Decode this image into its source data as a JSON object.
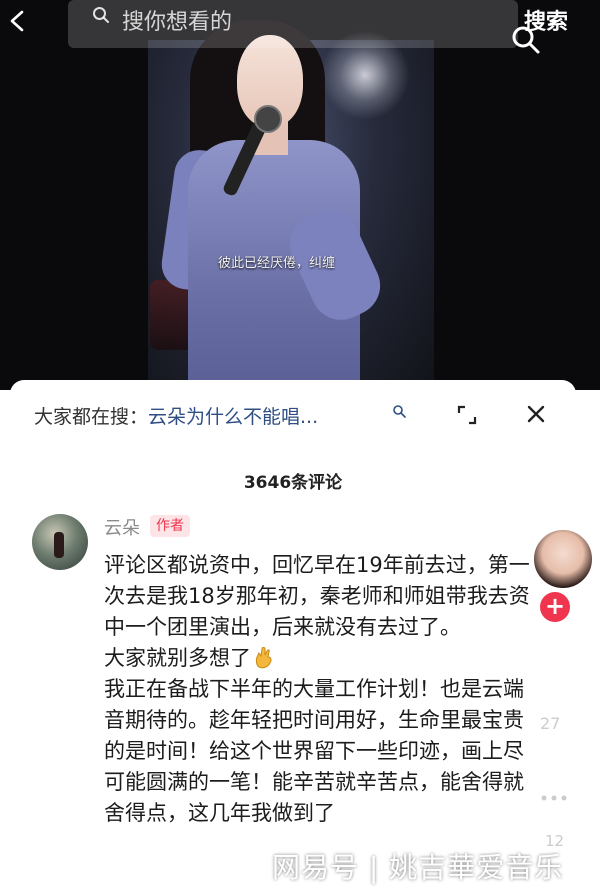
{
  "video": {
    "subtitle": "彼此已经厌倦，纠缠"
  },
  "top_bar": {
    "search_placeholder": "搜你想看的",
    "search_button": "搜索"
  },
  "comments_panel": {
    "hot_search_prefix": "大家都在搜：",
    "hot_search_query": "云朵为什么不能唱...",
    "comment_count": "3646条评论",
    "comment": {
      "author": "云朵",
      "author_badge": "作者",
      "text_part1": "评论区都说资中，回忆早在19年前去过，第一次去是我18岁那年初，秦老师和师姐带我去资中一个团里演出，后来就没有去过了。\n大家就别多想了",
      "text_part2": "\n我正在备战下半年的大量工作计划！也是云端音期待的。趁年轻把时间用好，生命里最宝贵的是时间！给这个世界留下一些印迹，画上尽可能圆满的一笔！能辛苦就辛苦点，能舍得就舍得点，这几年我做到了"
    }
  },
  "right_rail": {
    "like_count": "27",
    "comment_count": "12"
  },
  "watermark": "网易号 | 姚吉華爱音乐",
  "colors": {
    "accent_red": "#f0364f",
    "link_blue": "#2f4f84"
  }
}
